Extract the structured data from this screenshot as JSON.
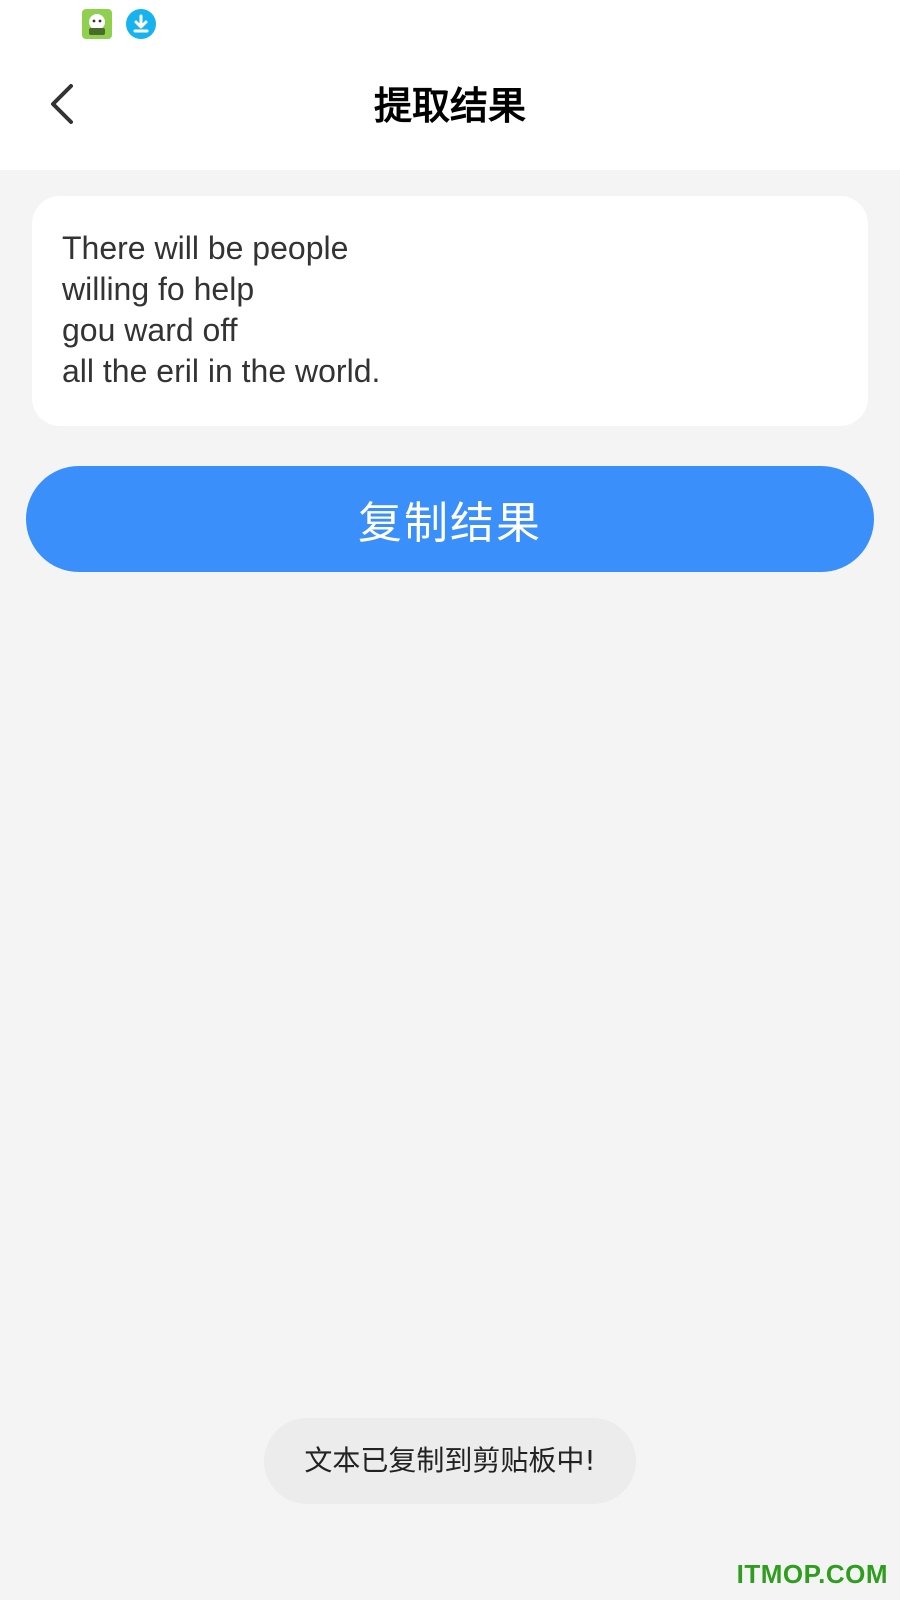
{
  "status_bar": {
    "icons": [
      "app-notification-icon",
      "download-icon"
    ],
    "colors": {
      "app_icon": "#8fd14f",
      "download_icon": "#16b3ef"
    }
  },
  "header": {
    "title": "提取结果",
    "back_icon": "chevron-left-icon"
  },
  "result": {
    "lines": [
      "There will be people",
      "willing fo help",
      "gou ward off",
      "all the eril in the world."
    ]
  },
  "copy_button": {
    "label": "复制结果",
    "color": "#3a8ffb"
  },
  "toast": {
    "message": "文本已复制到剪贴板中!"
  },
  "watermark": {
    "text": "ITMOP.COM",
    "color": "#2f9e1f"
  }
}
